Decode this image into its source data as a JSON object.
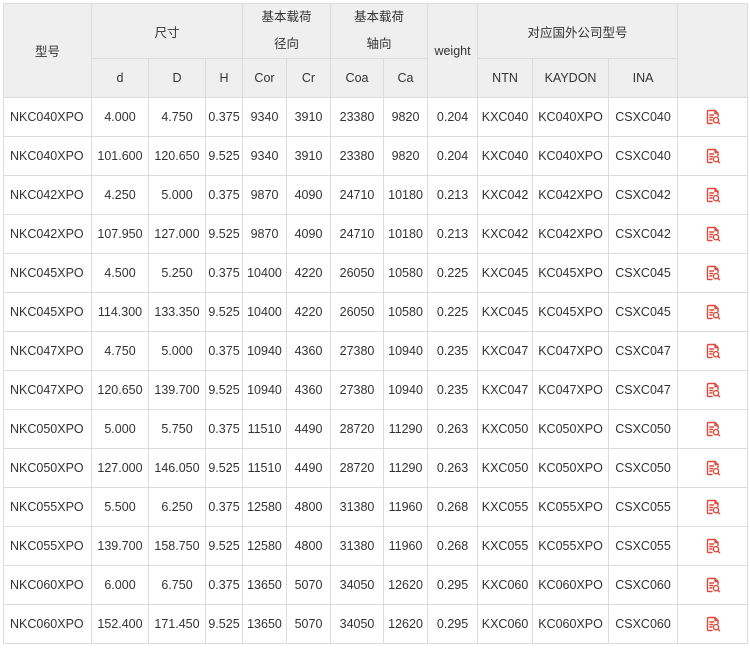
{
  "header": {
    "model": "型号",
    "dimensions": "尺寸",
    "radial_load_line1": "基本载荷",
    "radial_load_line2": "径向",
    "axial_load_line1": "基本载荷",
    "axial_load_line2": "轴向",
    "weight": "weight",
    "foreign_models": "对应国外公司型号",
    "sub": {
      "d": "d",
      "D": "D",
      "H": "H",
      "Cor": "Cor",
      "Cr": "Cr",
      "Coa": "Coa",
      "Ca": "Ca",
      "NTN": "NTN",
      "KAYDON": "KAYDON",
      "INA": "INA"
    }
  },
  "icon_color": "#e0483c",
  "row_icon": "document-search-icon",
  "rows": [
    {
      "model": "NKC040XPO",
      "d": "4.000",
      "D": "4.750",
      "H": "0.375",
      "Cor": "9340",
      "Cr": "3910",
      "Coa": "23380",
      "Ca": "9820",
      "weight": "0.204",
      "NTN": "KXC040",
      "KAYDON": "KC040XPO",
      "INA": "CSXC040"
    },
    {
      "model": "NKC040XPO",
      "d": "101.600",
      "D": "120.650",
      "H": "9.525",
      "Cor": "9340",
      "Cr": "3910",
      "Coa": "23380",
      "Ca": "9820",
      "weight": "0.204",
      "NTN": "KXC040",
      "KAYDON": "KC040XPO",
      "INA": "CSXC040"
    },
    {
      "model": "NKC042XPO",
      "d": "4.250",
      "D": "5.000",
      "H": "0.375",
      "Cor": "9870",
      "Cr": "4090",
      "Coa": "24710",
      "Ca": "10180",
      "weight": "0.213",
      "NTN": "KXC042",
      "KAYDON": "KC042XPO",
      "INA": "CSXC042"
    },
    {
      "model": "NKC042XPO",
      "d": "107.950",
      "D": "127.000",
      "H": "9.525",
      "Cor": "9870",
      "Cr": "4090",
      "Coa": "24710",
      "Ca": "10180",
      "weight": "0.213",
      "NTN": "KXC042",
      "KAYDON": "KC042XPO",
      "INA": "CSXC042"
    },
    {
      "model": "NKC045XPO",
      "d": "4.500",
      "D": "5.250",
      "H": "0.375",
      "Cor": "10400",
      "Cr": "4220",
      "Coa": "26050",
      "Ca": "10580",
      "weight": "0.225",
      "NTN": "KXC045",
      "KAYDON": "KC045XPO",
      "INA": "CSXC045"
    },
    {
      "model": "NKC045XPO",
      "d": "114.300",
      "D": "133.350",
      "H": "9.525",
      "Cor": "10400",
      "Cr": "4220",
      "Coa": "26050",
      "Ca": "10580",
      "weight": "0.225",
      "NTN": "KXC045",
      "KAYDON": "KC045XPO",
      "INA": "CSXC045"
    },
    {
      "model": "NKC047XPO",
      "d": "4.750",
      "D": "5.000",
      "H": "0.375",
      "Cor": "10940",
      "Cr": "4360",
      "Coa": "27380",
      "Ca": "10940",
      "weight": "0.235",
      "NTN": "KXC047",
      "KAYDON": "KC047XPO",
      "INA": "CSXC047"
    },
    {
      "model": "NKC047XPO",
      "d": "120.650",
      "D": "139.700",
      "H": "9.525",
      "Cor": "10940",
      "Cr": "4360",
      "Coa": "27380",
      "Ca": "10940",
      "weight": "0.235",
      "NTN": "KXC047",
      "KAYDON": "KC047XPO",
      "INA": "CSXC047"
    },
    {
      "model": "NKC050XPO",
      "d": "5.000",
      "D": "5.750",
      "H": "0.375",
      "Cor": "11510",
      "Cr": "4490",
      "Coa": "28720",
      "Ca": "11290",
      "weight": "0.263",
      "NTN": "KXC050",
      "KAYDON": "KC050XPO",
      "INA": "CSXC050"
    },
    {
      "model": "NKC050XPO",
      "d": "127.000",
      "D": "146.050",
      "H": "9.525",
      "Cor": "11510",
      "Cr": "4490",
      "Coa": "28720",
      "Ca": "11290",
      "weight": "0.263",
      "NTN": "KXC050",
      "KAYDON": "KC050XPO",
      "INA": "CSXC050"
    },
    {
      "model": "NKC055XPO",
      "d": "5.500",
      "D": "6.250",
      "H": "0.375",
      "Cor": "12580",
      "Cr": "4800",
      "Coa": "31380",
      "Ca": "11960",
      "weight": "0.268",
      "NTN": "KXC055",
      "KAYDON": "KC055XPO",
      "INA": "CSXC055"
    },
    {
      "model": "NKC055XPO",
      "d": "139.700",
      "D": "158.750",
      "H": "9.525",
      "Cor": "12580",
      "Cr": "4800",
      "Coa": "31380",
      "Ca": "11960",
      "weight": "0.268",
      "NTN": "KXC055",
      "KAYDON": "KC055XPO",
      "INA": "CSXC055"
    },
    {
      "model": "NKC060XPO",
      "d": "6.000",
      "D": "6.750",
      "H": "0.375",
      "Cor": "13650",
      "Cr": "5070",
      "Coa": "34050",
      "Ca": "12620",
      "weight": "0.295",
      "NTN": "KXC060",
      "KAYDON": "KC060XPO",
      "INA": "CSXC060"
    },
    {
      "model": "NKC060XPO",
      "d": "152.400",
      "D": "171.450",
      "H": "9.525",
      "Cor": "13650",
      "Cr": "5070",
      "Coa": "34050",
      "Ca": "12620",
      "weight": "0.295",
      "NTN": "KXC060",
      "KAYDON": "KC060XPO",
      "INA": "CSXC060"
    }
  ]
}
